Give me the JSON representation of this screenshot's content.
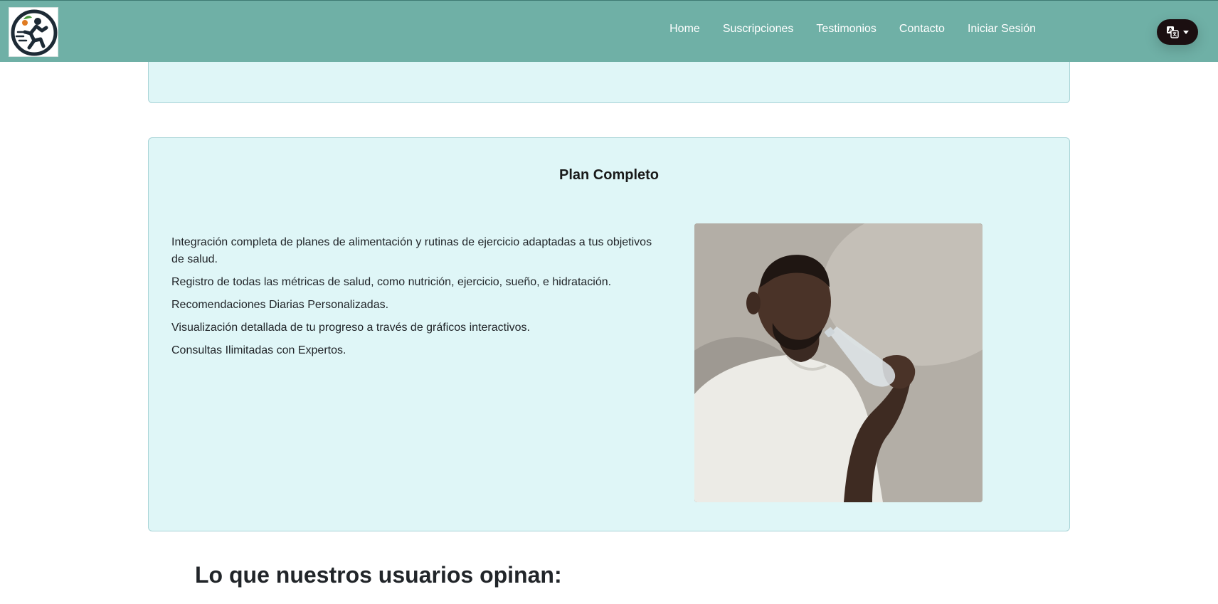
{
  "navbar": {
    "logo_alt": "logo",
    "links": [
      {
        "label": "Home"
      },
      {
        "label": "Suscripciones"
      },
      {
        "label": "Testimonios"
      },
      {
        "label": "Contacto"
      },
      {
        "label": "Iniciar Sesión"
      }
    ],
    "language_icon": "translate-icon",
    "dropdown_icon": "caret-down-icon",
    "background_color": "#6fb0a6"
  },
  "plan": {
    "title": "Plan Completo",
    "features": [
      "Integración completa de planes de alimentación y rutinas de ejercicio adaptadas a tus objetivos de salud.",
      "Registro de todas las métricas de salud, como nutrición, ejercicio, sueño, e hidratación.",
      "Recomendaciones Diarias Personalizadas.",
      "Visualización detallada de tu progreso a través de gráficos interactivos.",
      "Consultas Ilimitadas con Expertos."
    ],
    "card_color": "#dff6f7"
  },
  "testimonials": {
    "heading": "Lo que nuestros usuarios opinan:"
  }
}
